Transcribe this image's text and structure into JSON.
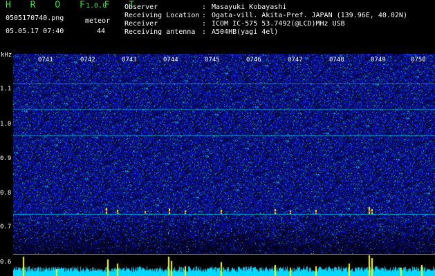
{
  "app": {
    "name": "H R O F F T",
    "version": "1.0.0"
  },
  "capture": {
    "filename": "0505170740.png",
    "datetime": "05.05.17 07:40",
    "meteor_label": "meteor",
    "meteor_count": "44"
  },
  "info": [
    {
      "label": "Observer",
      "sep": ":",
      "value": "Masayuki Kobayashi"
    },
    {
      "label": "Receiving Location",
      "sep": ":",
      "value": "Ogata-vill. Akita-Pref. JAPAN (139.96E, 40.02N)"
    },
    {
      "label": "Receiver",
      "sep": ":",
      "value": "ICOM IC-575 53.7492(@LCD)MHz USB"
    },
    {
      "label": "Receiving antenna",
      "sep": ":",
      "value": "A504HB(yagi 4el)"
    }
  ],
  "axis": {
    "unit": "kHz",
    "y_ticks": [
      "1.1",
      "1.0",
      "0.9",
      "0.8",
      "0.7",
      "0.6"
    ],
    "x_ticks": [
      "0741",
      "0742",
      "0743",
      "0744",
      "0745",
      "0746",
      "0747",
      "0748",
      "0749",
      "0750"
    ]
  },
  "colors": {
    "title_green": "#3fdc3f",
    "background": "#000000",
    "noise_blue": "#1a2bd0",
    "trace_cyan": "#00ffff",
    "trace_yellow": "#ffff00"
  }
}
